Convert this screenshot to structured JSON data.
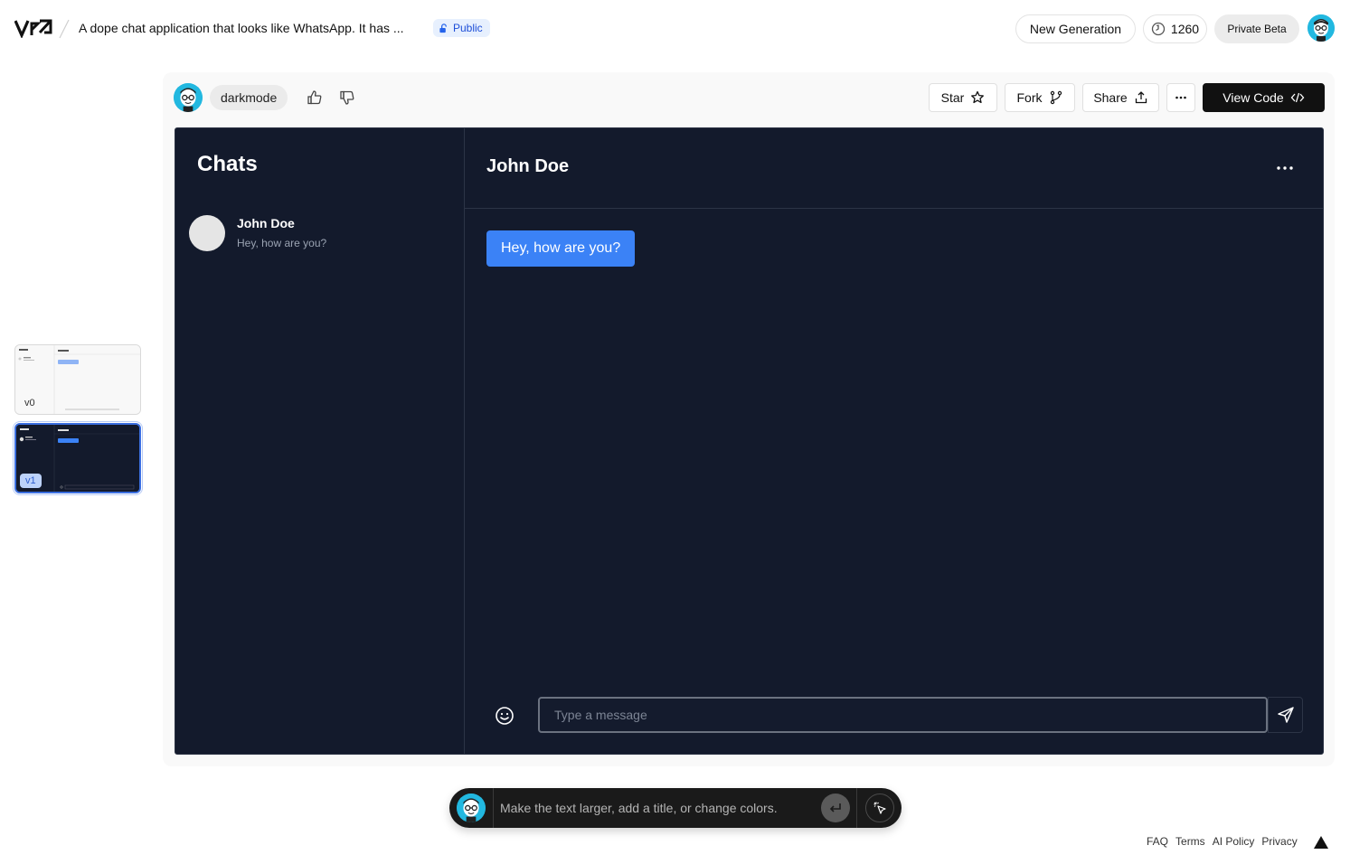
{
  "header": {
    "project_title": "A dope chat application that looks like WhatsApp. It has ...",
    "visibility_badge": "Public",
    "new_generation_label": "New Generation",
    "credits": "1260",
    "beta_label": "Private Beta"
  },
  "versions": [
    {
      "label": "v0",
      "selected": false
    },
    {
      "label": "v1",
      "selected": true
    }
  ],
  "toolbar": {
    "tag": "darkmode",
    "star_label": "Star",
    "fork_label": "Fork",
    "share_label": "Share",
    "view_code_label": "View Code"
  },
  "preview": {
    "sidebar_title": "Chats",
    "contacts": [
      {
        "name": "John Doe",
        "last_message": "Hey, how are you?"
      }
    ],
    "active_chat": {
      "name": "John Doe",
      "messages": [
        {
          "text": "Hey, how are you?",
          "from_me": true
        }
      ]
    },
    "input_placeholder": "Type a message"
  },
  "prompt": {
    "placeholder": "Make the text larger, add a title, or change colors."
  },
  "footer": {
    "links": [
      "FAQ",
      "Terms",
      "AI Policy",
      "Privacy"
    ]
  },
  "colors": {
    "preview_bg": "#131a2c",
    "bubble": "#3b82f6",
    "selected_version": "#3b6fe0"
  }
}
